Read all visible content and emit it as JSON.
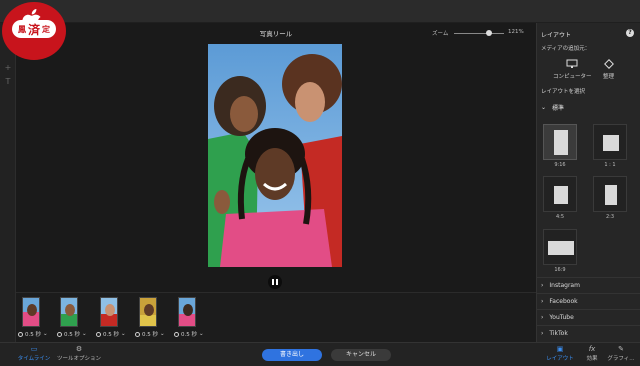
{
  "main": {
    "title": "写真リール",
    "zoom_label": "ズーム",
    "zoom_value": "121%",
    "zoom_level_percent": 121
  },
  "logo": {
    "left": "鳳",
    "center": "済",
    "right": "定"
  },
  "timeline": {
    "clips": [
      {
        "duration": "0.5 秒"
      },
      {
        "duration": "0.5 秒"
      },
      {
        "duration": "0.5 秒"
      },
      {
        "duration": "0.5 秒"
      },
      {
        "duration": "0.5 秒"
      }
    ]
  },
  "bottombar": {
    "tab_timeline": "タイムライン",
    "tab_tool_options": "ツールオプション",
    "export_button": "書き出し",
    "cancel_button": "キャンセル",
    "tab_layout": "レイアウト",
    "tab_effects": "効果",
    "tab_graphics": "グラフィ..."
  },
  "right_panel": {
    "title": "レイアウト",
    "add_media_label": "メディアの追加元：",
    "source_computer": "コンピューター",
    "source_organize": "整理",
    "select_layout_label": "レイアウトを選択",
    "standard_section": "標準",
    "layouts": [
      {
        "label": "9:16",
        "selected": true
      },
      {
        "label": "1 : 1",
        "selected": false
      },
      {
        "label": "4:5",
        "selected": false
      },
      {
        "label": "2:3",
        "selected": false
      },
      {
        "label": "16:9",
        "selected": false
      }
    ],
    "sections": [
      "Instagram",
      "Facebook",
      "YouTube",
      "TikTok"
    ]
  },
  "colors": {
    "accent": "#2f73e0",
    "logo_red": "#c8141c"
  },
  "icons": [
    "apple-logo-icon",
    "pause-icon",
    "monitor-icon",
    "organize-icon",
    "help-icon",
    "chevron-right-icon",
    "chevron-down-icon",
    "clock-icon",
    "timeline-icon",
    "tool-options-icon",
    "layout-icon",
    "fx-icon",
    "graphics-icon"
  ]
}
